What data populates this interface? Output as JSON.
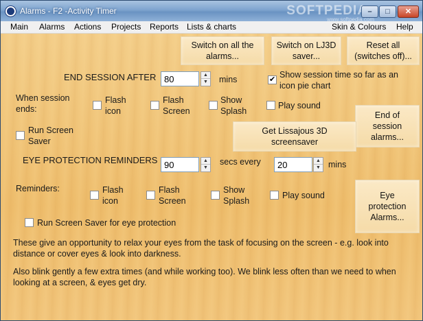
{
  "window": {
    "title": "Alarms - F2 -Activity Timer",
    "watermark": "SOFTPEDIA",
    "watermark_sub": "www.softpedia.com",
    "min_glyph": "–",
    "max_glyph": "□",
    "close_glyph": "✕"
  },
  "menu": {
    "main": "Main",
    "alarms": "Alarms",
    "actions": "Actions",
    "projects": "Projects",
    "reports": "Reports",
    "lists": "Lists & charts",
    "skin": "Skin & Colours",
    "help": "Help"
  },
  "buttons": {
    "switch_on_all_1": "Switch on all the",
    "switch_on_all_2": "alarms...",
    "switch_lj3d_1": "Switch on LJ3D",
    "switch_lj3d_2": "saver...",
    "reset_all_1": "Reset all",
    "reset_all_2": "(switches off)...",
    "lissajous_1": "Get Lissajous 3D",
    "lissajous_2": "screensaver",
    "end_session_1": "End of",
    "end_session_2": "session",
    "end_session_3": "alarms...",
    "eye_protection_1": "Eye",
    "eye_protection_2": "protection",
    "eye_protection_3": "Alarms..."
  },
  "session": {
    "end_after_label": "END SESSION AFTER",
    "end_after_value": "80",
    "end_after_unit": "mins",
    "show_pie_label_1": "Show session time so far as an",
    "show_pie_label_2": "icon pie chart",
    "show_pie_checked": true,
    "when_ends_1": "When session",
    "when_ends_2": "ends:",
    "flash_icon_1": "Flash",
    "flash_icon_2": "icon",
    "flash_screen_1": "Flash",
    "flash_screen_2": "Screen",
    "show_splash_1": "Show",
    "show_splash_2": "Splash",
    "play_sound": "Play sound",
    "run_saver_1": "Run Screen",
    "run_saver_2": "Saver"
  },
  "eye": {
    "reminders_label": "EYE PROTECTION REMINDERS",
    "secs_value": "90",
    "secs_every_label": "secs every",
    "mins_value": "20",
    "mins_label": "mins",
    "reminders_sub": "Reminders:",
    "flash_icon_1": "Flash",
    "flash_icon_2": "icon",
    "flash_screen_1": "Flash",
    "flash_screen_2": "Screen",
    "show_splash_1": "Show",
    "show_splash_2": "Splash",
    "play_sound": "Play sound",
    "run_saver_eye": "Run Screen Saver for eye protection"
  },
  "info": {
    "para1_1": "These give an opportunity to relax your eyes from the task of focusing on the screen - e.g. look into",
    "para1_2": "distance or cover eyes & look into darkness.",
    "para2_1": "Also blink gently a few extra times (and while working too). We blink less often than we need to when",
    "para2_2": "looking at a screen, & eyes get dry."
  }
}
